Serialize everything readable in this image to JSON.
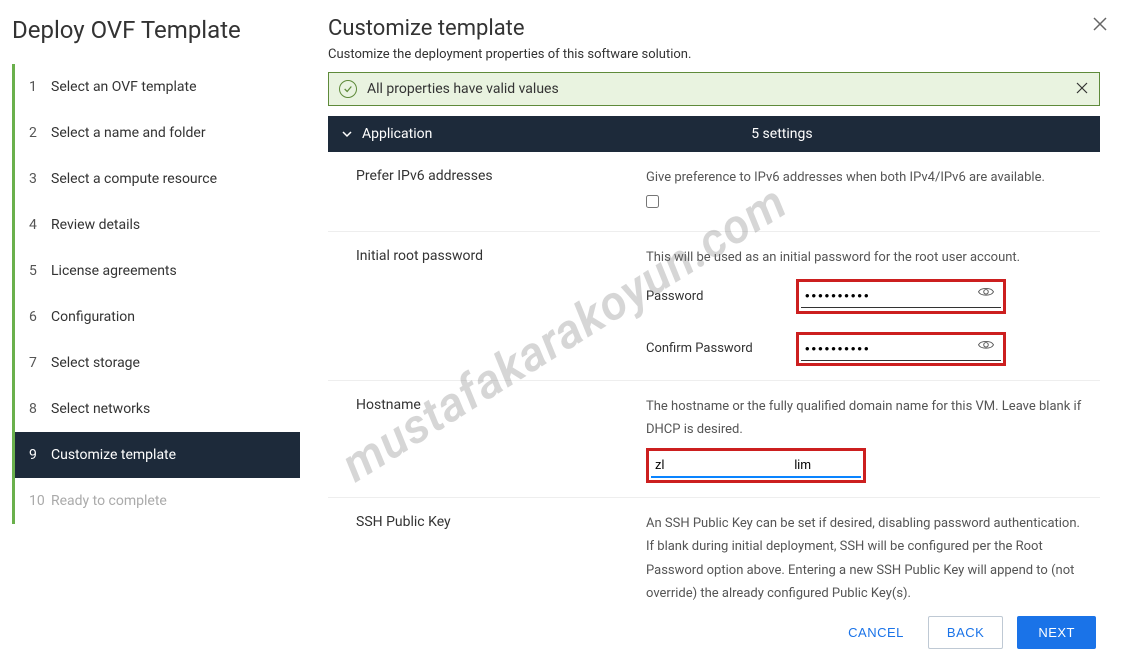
{
  "wizard_title": "Deploy OVF Template",
  "steps": [
    {
      "num": "1",
      "label": "Select an OVF template"
    },
    {
      "num": "2",
      "label": "Select a name and folder"
    },
    {
      "num": "3",
      "label": "Select a compute resource"
    },
    {
      "num": "4",
      "label": "Review details"
    },
    {
      "num": "5",
      "label": "License agreements"
    },
    {
      "num": "6",
      "label": "Configuration"
    },
    {
      "num": "7",
      "label": "Select storage"
    },
    {
      "num": "8",
      "label": "Select networks"
    },
    {
      "num": "9",
      "label": "Customize template"
    },
    {
      "num": "10",
      "label": "Ready to complete"
    }
  ],
  "page_title": "Customize template",
  "page_subtitle": "Customize the deployment properties of this software solution.",
  "alert_text": "All properties have valid values",
  "section": {
    "title": "Application",
    "count": "5 settings"
  },
  "prefer_ipv6": {
    "label": "Prefer IPv6 addresses",
    "desc": "Give preference to IPv6 addresses when both IPv4/IPv6 are available."
  },
  "root_pw": {
    "label": "Initial root password",
    "desc": "This will be used as an initial password for the root user account.",
    "pw_label": "Password",
    "confirm_label": "Confirm Password",
    "pw_value": "••••••••••",
    "confirm_value": "••••••••••"
  },
  "hostname": {
    "label": "Hostname",
    "desc": "The hostname or the fully qualified domain name for this VM. Leave blank if DHCP is desired.",
    "value": "zl                                    lim"
  },
  "ssh": {
    "label": "SSH Public Key",
    "desc": "An SSH Public Key can be set if desired, disabling password authentication. If blank during initial deployment, SSH will be configured per the Root Password option above. Entering a new SSH Public Key will append to (not override) the already configured Public Key(s)."
  },
  "buttons": {
    "cancel": "CANCEL",
    "back": "BACK",
    "next": "NEXT"
  },
  "watermark": "mustafakarakoyun.com"
}
